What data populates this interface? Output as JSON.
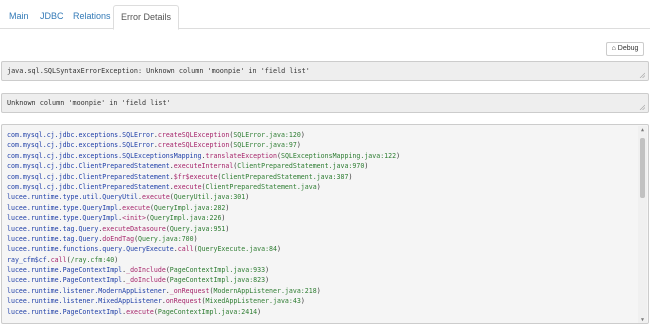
{
  "tabs": [
    {
      "label": "Main",
      "active": false
    },
    {
      "label": "JDBC",
      "active": false
    },
    {
      "label": "Relations",
      "active": false
    },
    {
      "label": "Error Details",
      "active": true
    }
  ],
  "debug_button": {
    "label": "Debug",
    "icon": "home-icon"
  },
  "exception_type": "java.sql.SQLSyntaxErrorException: Unknown column 'moonpie' in 'field list'",
  "exception_message": "Unknown column 'moonpie' in 'field list'",
  "stack_trace": [
    {
      "cls": "com.mysql.cj.jdbc.exceptions.SQLError",
      "method": "createSQLException",
      "src": "SQLError.java:120"
    },
    {
      "cls": "com.mysql.cj.jdbc.exceptions.SQLError",
      "method": "createSQLException",
      "src": "SQLError.java:97"
    },
    {
      "cls": "com.mysql.cj.jdbc.exceptions.SQLExceptionsMapping",
      "method": "translateException",
      "src": "SQLExceptionsMapping.java:122"
    },
    {
      "cls": "com.mysql.cj.jdbc.ClientPreparedStatement",
      "method": "executeInternal",
      "src": "ClientPreparedStatement.java:970"
    },
    {
      "cls": "com.mysql.cj.jdbc.ClientPreparedStatement",
      "method": "$fr$execute",
      "src": "ClientPreparedStatement.java:387"
    },
    {
      "cls": "com.mysql.cj.jdbc.ClientPreparedStatement",
      "method": "execute",
      "src": "ClientPreparedStatement.java"
    },
    {
      "cls": "lucee.runtime.type.util.QueryUtil",
      "method": "execute",
      "src": "QueryUtil.java:301"
    },
    {
      "cls": "lucee.runtime.type.QueryImpl",
      "method": "execute",
      "src": "QueryImpl.java:282"
    },
    {
      "cls": "lucee.runtime.type.QueryImpl",
      "method": "<init>",
      "src": "QueryImpl.java:226"
    },
    {
      "cls": "lucee.runtime.tag.Query",
      "method": "executeDatasoure",
      "src": "Query.java:951"
    },
    {
      "cls": "lucee.runtime.tag.Query",
      "method": "doEndTag",
      "src": "Query.java:700"
    },
    {
      "cls": "lucee.runtime.functions.query.QueryExecute",
      "method": "call",
      "src": "QueryExecute.java:84"
    },
    {
      "cls": "ray_cfm$cf",
      "method": "call",
      "src": "/ray.cfm:40"
    },
    {
      "cls": "lucee.runtime.PageContextImpl",
      "method": "_doInclude",
      "src": "PageContextImpl.java:933"
    },
    {
      "cls": "lucee.runtime.PageContextImpl",
      "method": "_doInclude",
      "src": "PageContextImpl.java:823"
    },
    {
      "cls": "lucee.runtime.listener.ModernAppListener",
      "method": "_onRequest",
      "src": "ModernAppListener.java:218"
    },
    {
      "cls": "lucee.runtime.listener.MixedAppListener",
      "method": "onRequest",
      "src": "MixedAppListener.java:43"
    },
    {
      "cls": "lucee.runtime.PageContextImpl",
      "method": "execute",
      "src": "PageContextImpl.java:2414"
    }
  ],
  "colors": {
    "class": "#1f3fa8",
    "method": "#a6246a",
    "source": "#2e7d32",
    "link": "#337ab7"
  }
}
